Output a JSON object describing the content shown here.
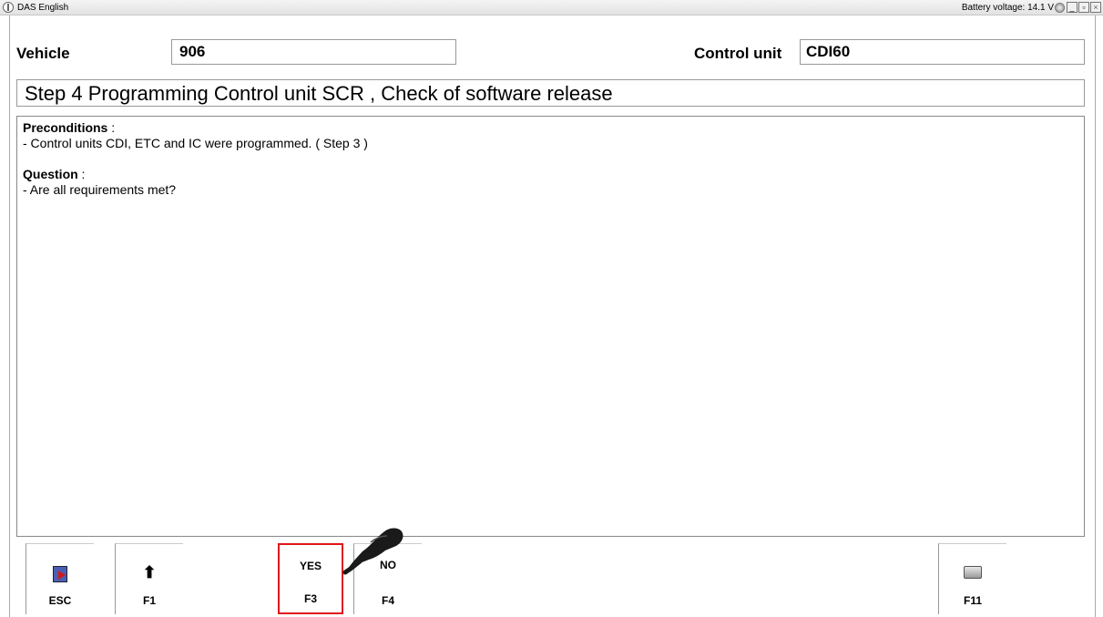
{
  "titlebar": {
    "app_title": "DAS English",
    "battery": "Battery voltage: 14.1 V",
    "min": "_",
    "max": "▫",
    "close": "×"
  },
  "header": {
    "vehicle_label": "Vehicle",
    "vehicle_value": "906",
    "control_unit_label": "Control unit",
    "control_unit_value": "CDI60"
  },
  "step_title": "Step 4 Programming Control unit SCR , Check of software release",
  "content": {
    "preconditions_heading": "Preconditions",
    "preconditions_colon": " :",
    "precondition_text": "- Control units CDI, ETC and IC were programmed. ( Step 3 )",
    "question_heading": "Question",
    "question_colon": " :",
    "question_text": "- Are all requirements met?"
  },
  "fkeys": {
    "esc": "ESC",
    "f1": "F1",
    "f3_top": "YES",
    "f3": "F3",
    "f4_top": "NO",
    "f4": "F4",
    "f11": "F11"
  },
  "icons": {
    "app": "mercedes-star-icon",
    "battery": "battery-status-icon",
    "esc": "exit-door-icon",
    "f1": "arrow-up-icon",
    "f11": "printer-icon",
    "pointer": "pointing-hand-icon"
  },
  "colors": {
    "highlight": "#e0141b"
  }
}
